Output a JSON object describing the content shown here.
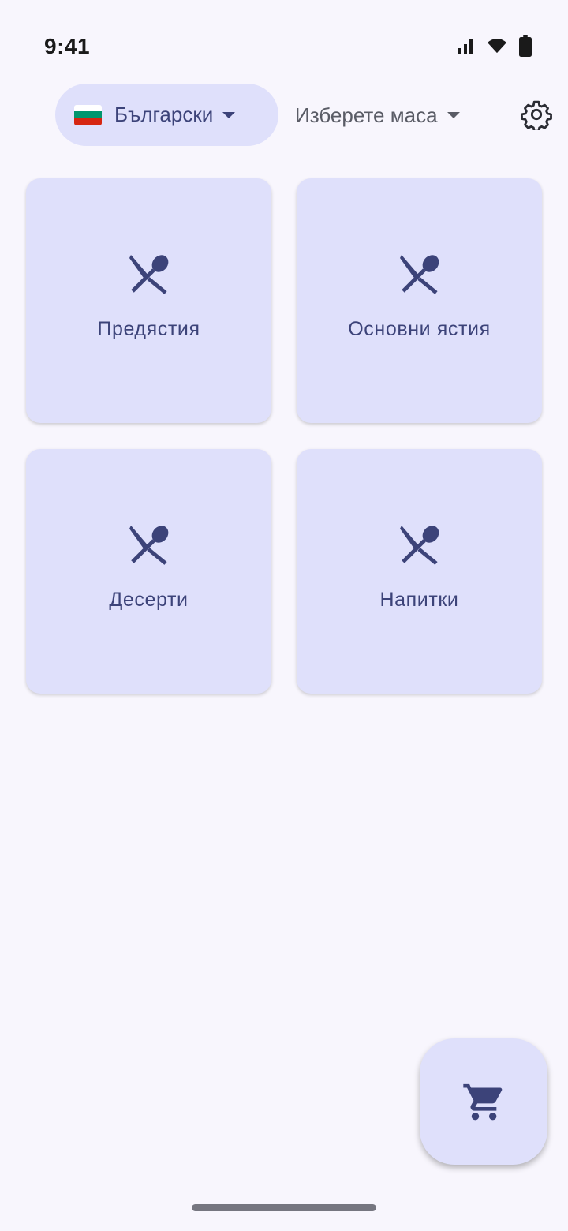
{
  "status_bar": {
    "time": "9:41",
    "icons": [
      "signal-icon",
      "wifi-icon",
      "battery-icon"
    ]
  },
  "toolbar": {
    "language": {
      "flag_icon": "bulgarian-flag-icon",
      "label": "Български",
      "flag_colors": [
        "#ffffff",
        "#00966e",
        "#d62612"
      ]
    },
    "table_select": {
      "label": "Изберете маса"
    },
    "settings_icon": "gear-icon"
  },
  "categories": [
    {
      "label": "Предястия",
      "icon": "utensils-icon"
    },
    {
      "label": "Основни ястия",
      "icon": "utensils-icon"
    },
    {
      "label": "Десерти",
      "icon": "utensils-icon"
    },
    {
      "label": "Напитки",
      "icon": "utensils-icon"
    }
  ],
  "fab": {
    "icon": "shopping-cart-icon"
  },
  "colors": {
    "background": "#f8f6fd",
    "card": "#dfe0fb",
    "accent": "#3c4379"
  }
}
